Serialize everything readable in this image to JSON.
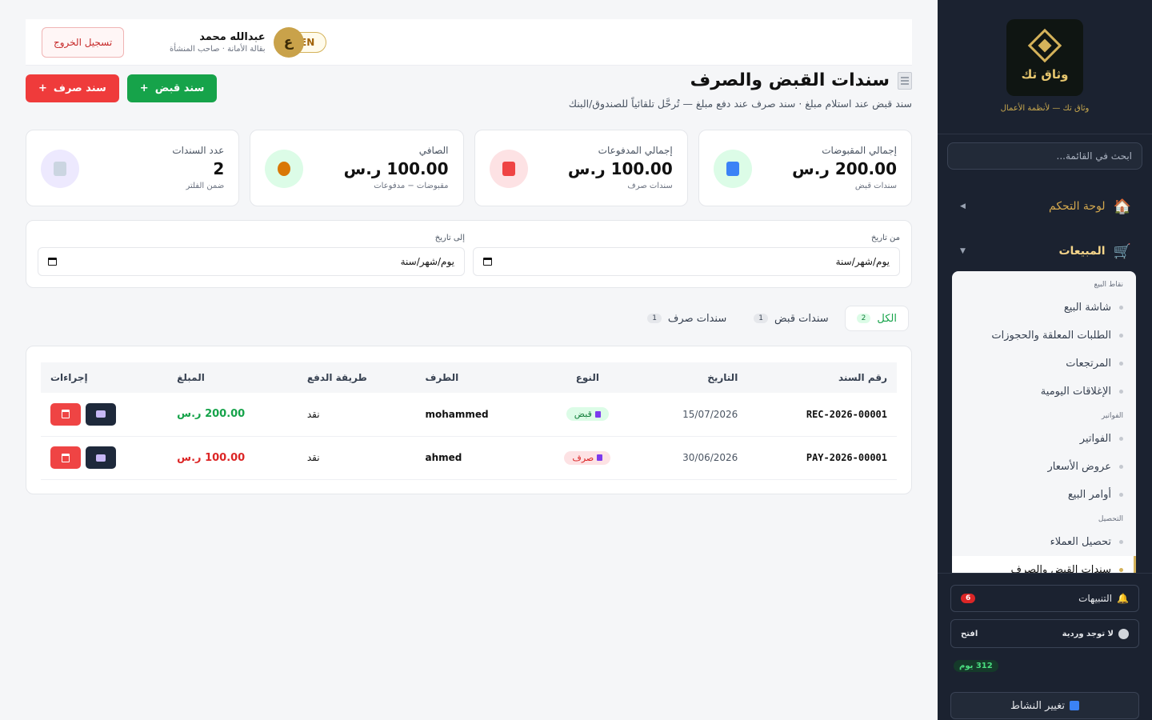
{
  "sidebar": {
    "logo_text": "وثاق تك",
    "tagline": "وثاق تك — لأنظمة الأعمال",
    "search_placeholder": "ابحث في القائمة...",
    "dashboard_label": "لوحة التحكم",
    "sales_label": "المبيعات",
    "groups": {
      "pos": "نقاط البيع",
      "invoices": "الفواتير",
      "collection": "التحصيل"
    },
    "items": [
      "شاشة البيع",
      "الطلبات المعلقة والحجوزات",
      "المرتجعات",
      "الإغلاقات اليومية",
      "الفواتير",
      "عروض الأسعار",
      "أوامر البيع",
      "تحصيل العملاء",
      "سندات القبض والصرف"
    ],
    "notifications_label": "التنبيهات",
    "notifications_count": "6",
    "shift_status": "لا توجد وردية",
    "shift_open": "افتح",
    "days_left": "312 يوم",
    "switch_label": "تغيير النشاط"
  },
  "topbar": {
    "logout": "تسجيل الخروج",
    "user_name": "عبدالله محمد",
    "user_role": "بقالة الأمانة · صاحب المنشأة",
    "avatar_letter": "ع",
    "lang": "EN"
  },
  "header": {
    "title": "سندات القبض والصرف",
    "subtitle": "سند قبض عند استلام مبلغ · سند صرف عند دفع مبلغ — تُرحَّل تلقائياً للصندوق/البنك",
    "btn_receipt": "سند قبض",
    "btn_payment": "سند صرف"
  },
  "stats": [
    {
      "label": "إجمالي المقبوضات",
      "value": "200.00 ر.س",
      "note": "سندات قبض"
    },
    {
      "label": "إجمالي المدفوعات",
      "value": "100.00 ر.س",
      "note": "سندات صرف"
    },
    {
      "label": "الصافي",
      "value": "100.00 ر.س",
      "note": "مقبوضات − مدفوعات"
    },
    {
      "label": "عدد السندات",
      "value": "2",
      "note": "ضمن الفلتر"
    }
  ],
  "filters": {
    "from_label": "من تاريخ",
    "to_label": "إلى تاريخ",
    "date_placeholder": "يوم/شهر/سنة"
  },
  "tabs": [
    {
      "label": "الكل",
      "count": "2"
    },
    {
      "label": "سندات قبض",
      "count": "1"
    },
    {
      "label": "سندات صرف",
      "count": "1"
    }
  ],
  "table": {
    "headers": [
      "رقم السند",
      "التاريخ",
      "النوع",
      "الطرف",
      "طريقة الدفع",
      "المبلغ",
      "إجراءات"
    ],
    "rows": [
      {
        "no": "REC-2026-00001",
        "date": "15/07/2026",
        "type": "قبض",
        "party": "mohammed",
        "method": "نقد",
        "amount": "200.00 ر.س"
      },
      {
        "no": "PAY-2026-00001",
        "date": "30/06/2026",
        "type": "صرف",
        "party": "ahmed",
        "method": "نقد",
        "amount": "100.00 ر.س"
      }
    ]
  }
}
